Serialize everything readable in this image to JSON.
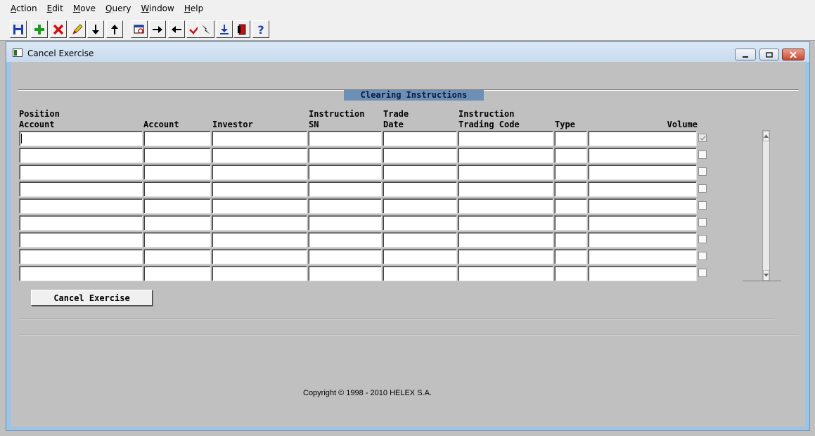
{
  "menu": [
    {
      "key": "A",
      "rest": "ction"
    },
    {
      "key": "E",
      "rest": "dit"
    },
    {
      "key": "M",
      "rest": "ove"
    },
    {
      "key": "Q",
      "rest": "uery"
    },
    {
      "key": "W",
      "rest": "indow"
    },
    {
      "key": "H",
      "rest": "elp"
    }
  ],
  "toolbar_icons": [
    "save-icon",
    "add-icon",
    "delete-icon",
    "edit-icon",
    "arrow-down-icon",
    "arrow-up-icon",
    "query-icon",
    "arrow-right-icon",
    "arrow-left-icon",
    "checkmark-icon",
    "flash-icon",
    "download-icon",
    "exit-icon",
    "help-icon"
  ],
  "window": {
    "title": "Cancel Exercise"
  },
  "section": {
    "title": "Clearing Instructions"
  },
  "columns": [
    {
      "line1": "Position",
      "line2": "Account"
    },
    {
      "line1": "",
      "line2": "Account"
    },
    {
      "line1": "",
      "line2": "Investor"
    },
    {
      "line1": "Instruction",
      "line2": "SN"
    },
    {
      "line1": "Trade",
      "line2": "Date"
    },
    {
      "line1": "Instruction",
      "line2": "Trading Code"
    },
    {
      "line1": "",
      "line2": "Type"
    },
    {
      "line1": "",
      "line2": "Volume"
    }
  ],
  "rows": [
    {
      "values": [
        "",
        "",
        "",
        "",
        "",
        "",
        "",
        ""
      ],
      "selected": true
    },
    {
      "values": [
        "",
        "",
        "",
        "",
        "",
        "",
        "",
        ""
      ],
      "selected": false
    },
    {
      "values": [
        "",
        "",
        "",
        "",
        "",
        "",
        "",
        ""
      ],
      "selected": false
    },
    {
      "values": [
        "",
        "",
        "",
        "",
        "",
        "",
        "",
        ""
      ],
      "selected": false
    },
    {
      "values": [
        "",
        "",
        "",
        "",
        "",
        "",
        "",
        ""
      ],
      "selected": false
    },
    {
      "values": [
        "",
        "",
        "",
        "",
        "",
        "",
        "",
        ""
      ],
      "selected": false
    },
    {
      "values": [
        "",
        "",
        "",
        "",
        "",
        "",
        "",
        ""
      ],
      "selected": false
    },
    {
      "values": [
        "",
        "",
        "",
        "",
        "",
        "",
        "",
        ""
      ],
      "selected": false
    },
    {
      "values": [
        "",
        "",
        "",
        "",
        "",
        "",
        "",
        ""
      ],
      "selected": false
    }
  ],
  "buttons": {
    "cancel_exercise": "Cancel Exercise"
  },
  "footer": {
    "copyright": "Copyright © 1998 - 2010 HELEX S.A."
  },
  "colors": {
    "section_title_bg": "#6c8fb6",
    "form_bg": "#c0c0c0",
    "window_frame": "#9cc4e4"
  }
}
